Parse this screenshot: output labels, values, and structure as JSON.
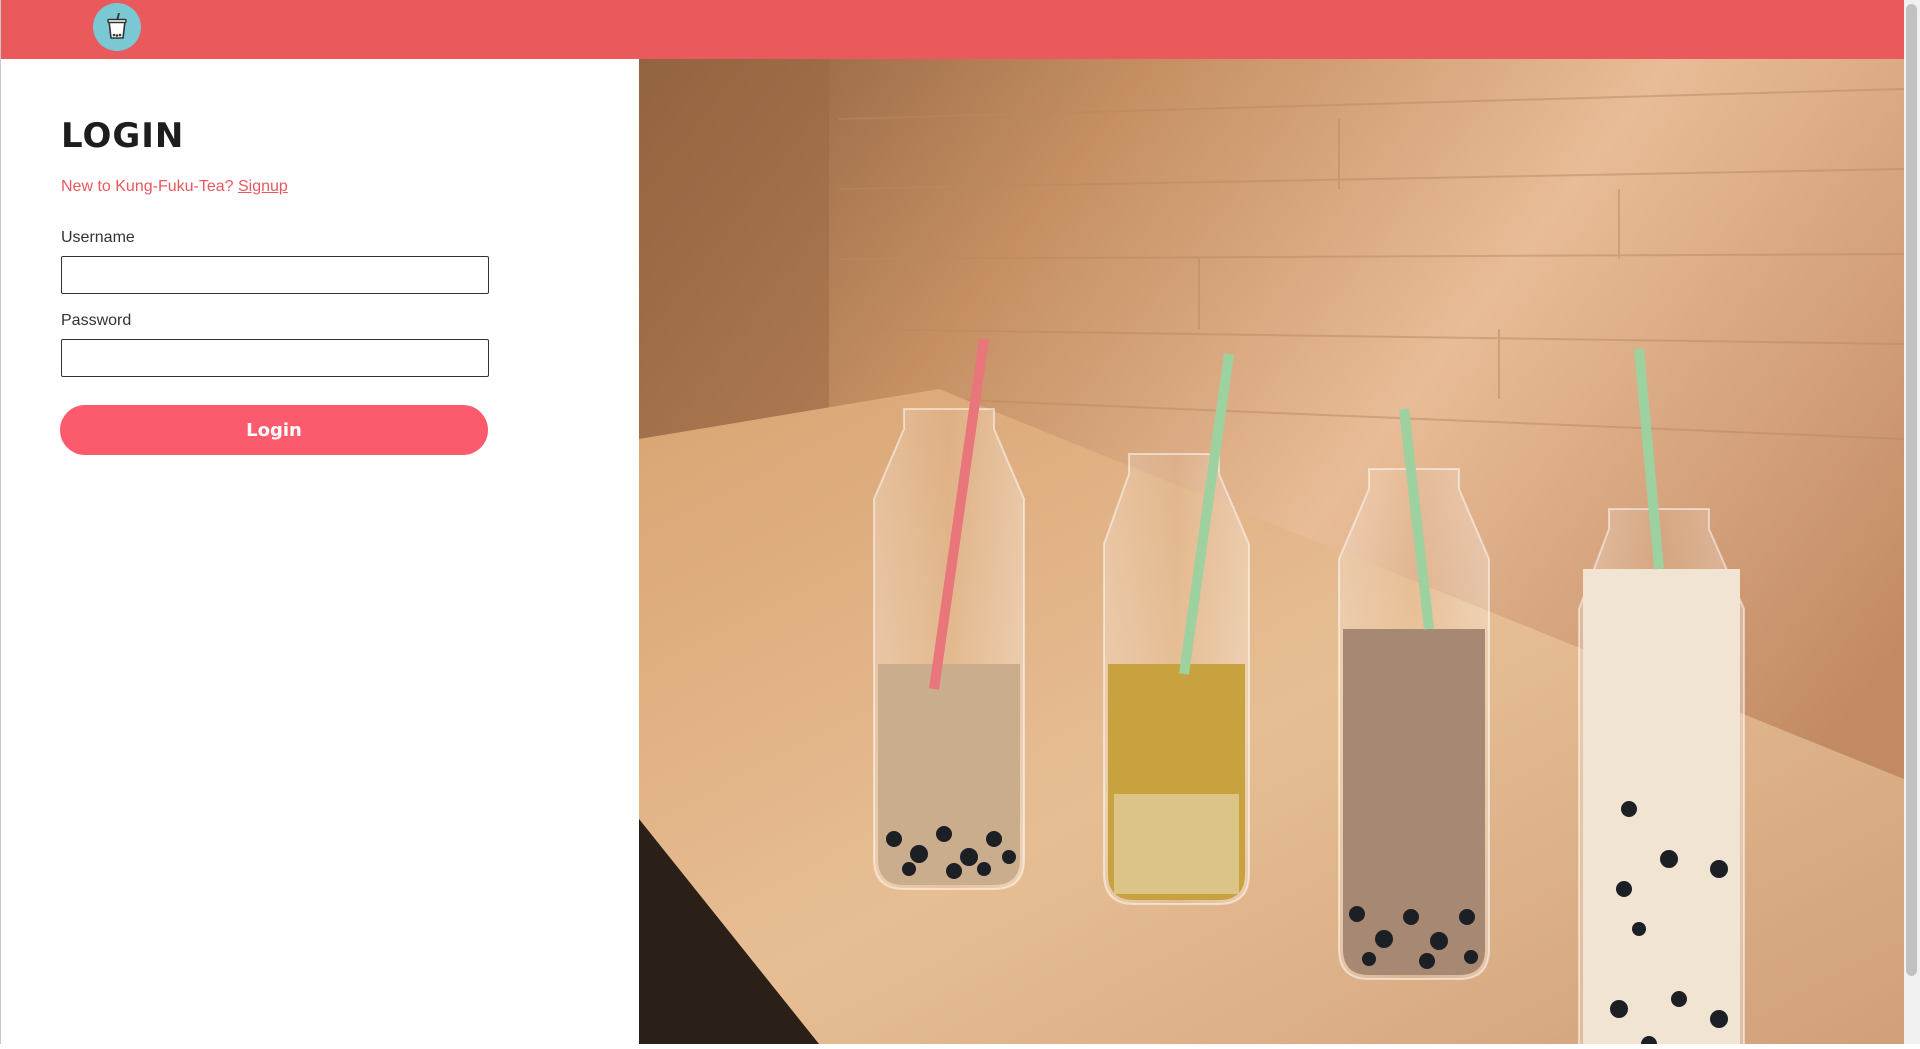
{
  "header": {
    "logo_icon": "bubble-tea-cup-icon",
    "background_color": "#ea5a5d"
  },
  "login": {
    "title": "LOGIN",
    "signup_prompt": "New to Kung-Fuku-Tea?",
    "signup_link": "Signup",
    "username_label": "Username",
    "username_value": "",
    "password_label": "Password",
    "password_value": "",
    "button_label": "Login",
    "accent_color": "#fb5b6c"
  },
  "hero_image": {
    "subject": "bubble-tea-bottles-photo"
  }
}
